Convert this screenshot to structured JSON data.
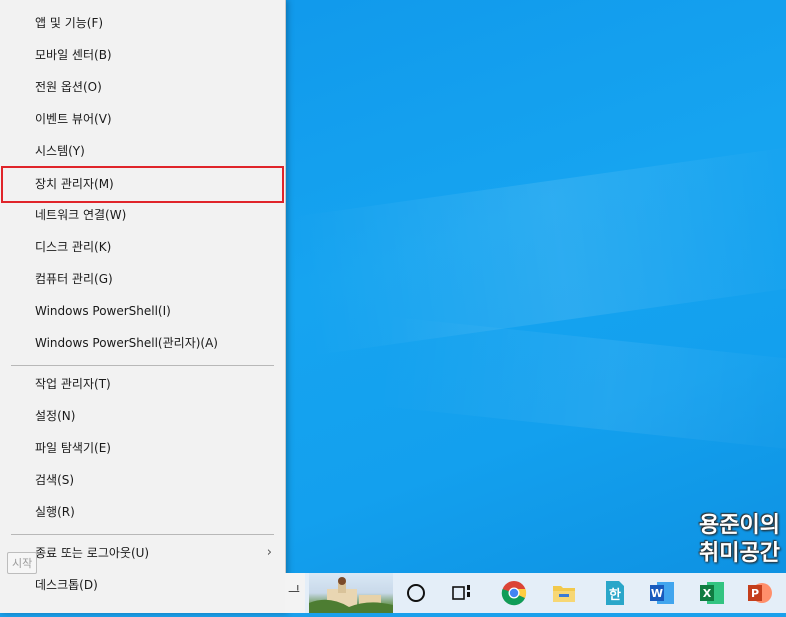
{
  "menu": {
    "items": [
      {
        "label": "앱 및 기능(F)"
      },
      {
        "label": "모바일 센터(B)"
      },
      {
        "label": "전원 옵션(O)"
      },
      {
        "label": "이벤트 뷰어(V)"
      },
      {
        "label": "시스템(Y)"
      },
      {
        "label": "장치 관리자(M)",
        "highlighted": true
      },
      {
        "label": "네트워크 연결(W)"
      },
      {
        "label": "디스크 관리(K)"
      },
      {
        "label": "컴퓨터 관리(G)"
      },
      {
        "label": "Windows PowerShell(I)"
      },
      {
        "label": "Windows PowerShell(관리자)(A)"
      },
      {
        "label": "작업 관리자(T)"
      },
      {
        "label": "설정(N)"
      },
      {
        "label": "파일 탐색기(E)"
      },
      {
        "label": "검색(S)"
      },
      {
        "label": "실행(R)"
      },
      {
        "label": "종료 또는 로그아웃(U)",
        "submenu": true
      },
      {
        "label": "데스크톱(D)"
      }
    ],
    "highlight_color": "#e0242a"
  },
  "tooltip": "시작",
  "watermark": {
    "line1": "용준이의",
    "line2": "취미공간"
  },
  "taskbar": {
    "icons": [
      "cortana-icon",
      "task-view-icon",
      "chrome-icon",
      "file-explorer-icon",
      "hangul-icon",
      "word-icon",
      "excel-icon",
      "powerpoint-icon"
    ]
  }
}
